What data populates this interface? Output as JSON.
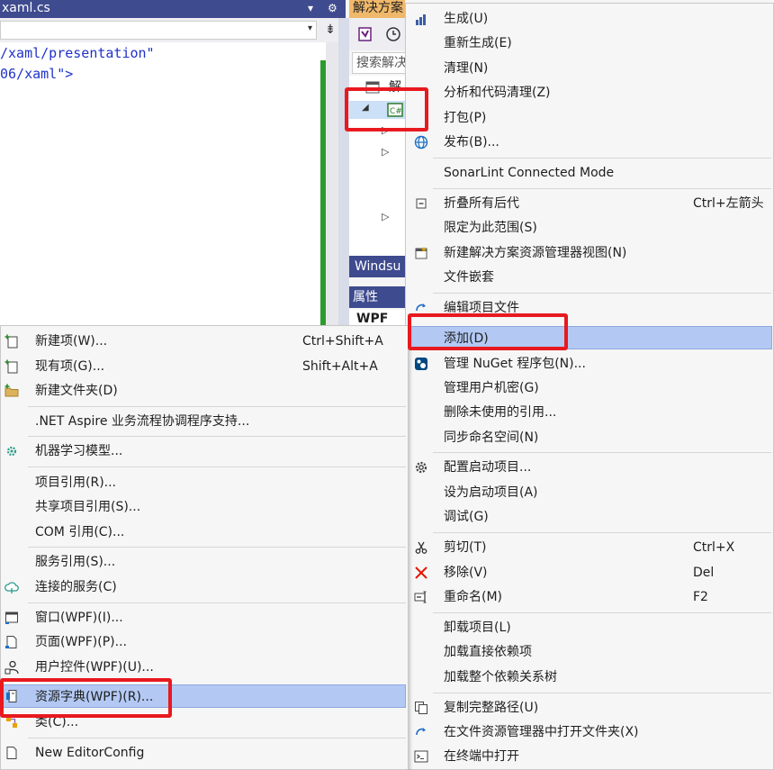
{
  "editor": {
    "tab_title": "xaml.cs",
    "tab_dropdown": "▾",
    "tab_settings": "⚙",
    "nav_dropdown": "▾",
    "split_toggle": "⇟",
    "code_lines": [
      "/xaml/presentation\"",
      "06/xaml\">"
    ]
  },
  "solution_explorer": {
    "title": "解决方案",
    "search_placeholder": "搜索解决",
    "tree_row_1": "解",
    "windsu_label": "Windsu",
    "properties_label": "属性",
    "properties_item": "WPF"
  },
  "context_menu": {
    "items": [
      {
        "label": "生成(U)",
        "icon": "build-icon"
      },
      {
        "label": "重新生成(E)"
      },
      {
        "label": "清理(N)"
      },
      {
        "label": "分析和代码清理(Z)"
      },
      {
        "label": "打包(P)"
      },
      {
        "label": "发布(B)...",
        "icon": "globe-publish-icon"
      },
      {
        "label": "SonarLint Connected Mode"
      },
      {
        "label": "折叠所有后代",
        "shortcut": "Ctrl+左箭头",
        "icon": "collapse-icon"
      },
      {
        "label": "限定为此范围(S)"
      },
      {
        "label": "新建解决方案资源管理器视图(N)",
        "icon": "new-view-icon"
      },
      {
        "label": "文件嵌套"
      },
      {
        "label": "编辑项目文件",
        "icon": "edit-file-icon"
      },
      {
        "label": "添加(D)"
      },
      {
        "label": "管理 NuGet 程序包(N)...",
        "icon": "nuget-icon"
      },
      {
        "label": "管理用户机密(G)"
      },
      {
        "label": "删除未使用的引用..."
      },
      {
        "label": "同步命名空间(N)"
      },
      {
        "label": "配置启动项目...",
        "icon": "gear-icon"
      },
      {
        "label": "设为启动项目(A)"
      },
      {
        "label": "调试(G)"
      },
      {
        "label": "剪切(T)",
        "shortcut": "Ctrl+X",
        "icon": "scissors-icon"
      },
      {
        "label": "移除(V)",
        "shortcut": "Del",
        "icon": "remove-x-icon"
      },
      {
        "label": "重命名(M)",
        "shortcut": "F2",
        "icon": "rename-icon"
      },
      {
        "label": "卸载项目(L)"
      },
      {
        "label": "加载直接依赖项"
      },
      {
        "label": "加载整个依赖关系树"
      },
      {
        "label": "复制完整路径(U)",
        "icon": "copy-path-icon"
      },
      {
        "label": "在文件资源管理器中打开文件夹(X)",
        "icon": "open-folder-icon"
      },
      {
        "label": "在终端中打开",
        "icon": "terminal-icon"
      }
    ]
  },
  "add_submenu": {
    "items": [
      {
        "label": "新建项(W)...",
        "shortcut": "Ctrl+Shift+A",
        "icon": "new-item-icon"
      },
      {
        "label": "现有项(G)...",
        "shortcut": "Shift+Alt+A",
        "icon": "existing-item-icon"
      },
      {
        "label": "新建文件夹(D)",
        "icon": "new-folder-icon"
      },
      {
        "label": ".NET Aspire 业务流程协调程序支持..."
      },
      {
        "label": "机器学习模型...",
        "icon": "ml-model-icon"
      },
      {
        "label": "项目引用(R)..."
      },
      {
        "label": "共享项目引用(S)..."
      },
      {
        "label": "COM 引用(C)..."
      },
      {
        "label": "服务引用(S)..."
      },
      {
        "label": "连接的服务(C)",
        "icon": "connected-service-icon"
      },
      {
        "label": "窗口(WPF)(I)...",
        "icon": "window-icon"
      },
      {
        "label": "页面(WPF)(P)...",
        "icon": "page-icon"
      },
      {
        "label": "用户控件(WPF)(U)...",
        "icon": "user-control-icon"
      },
      {
        "label": "资源字典(WPF)(R)...",
        "icon": "resource-dictionary-icon"
      },
      {
        "label": "类(C)...",
        "icon": "class-icon"
      },
      {
        "label": "New EditorConfig",
        "icon": "editorconfig-icon"
      }
    ]
  },
  "colors": {
    "highlight": "#b3c9f4",
    "annotation_red": "#e8191f",
    "tool_window_title": "#3f4b8f",
    "active_title": "#f0b86a",
    "code_text": "#1f32c8"
  }
}
